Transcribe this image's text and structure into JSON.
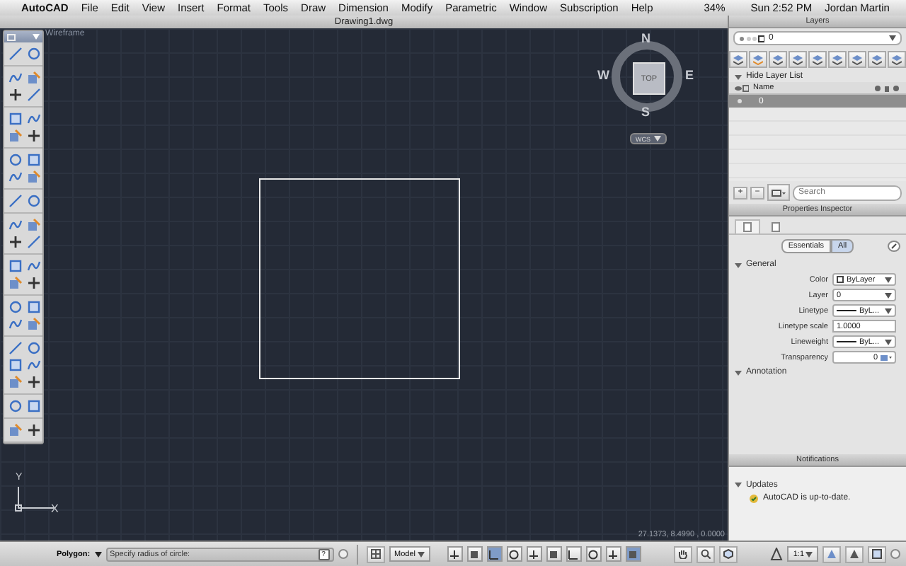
{
  "menu_bar": {
    "app": "AutoCAD",
    "items": [
      "File",
      "Edit",
      "View",
      "Insert",
      "Format",
      "Tools",
      "Draw",
      "Dimension",
      "Modify",
      "Parametric",
      "Window",
      "Subscription",
      "Help"
    ],
    "battery": "34%",
    "clock": "Sun 2:52 PM",
    "user": "Jordan Martin"
  },
  "drawing": {
    "title": "Drawing1.dwg",
    "visual_style": "Wireframe",
    "viewcube": {
      "face": "TOP",
      "north": "N",
      "south": "S",
      "east": "E",
      "west": "W",
      "ucs": "WCS"
    },
    "ucs_axis": {
      "y": "Y",
      "x": "X"
    },
    "coordinates": "27.1373, 8.4990 , 0.0000"
  },
  "layers": {
    "title": "Layers",
    "current_layer": "0",
    "hide_label": "Hide Layer List",
    "column": "Name",
    "rows": [
      {
        "name": "0",
        "selected": true
      }
    ],
    "buttons": [
      "+",
      "−"
    ],
    "search": {
      "placeholder": "Search"
    }
  },
  "properties": {
    "title": "Properties Inspector",
    "tabs": [
      {
        "selected": true
      },
      {
        "selected": false
      }
    ],
    "modes": [
      {
        "label": "Essentials",
        "selected": false
      },
      {
        "label": "All",
        "selected": true
      }
    ],
    "sections": [
      {
        "title": "General",
        "expanded": true,
        "rows": [
          {
            "label": "Color",
            "value": "ByLayer",
            "kind": "color"
          },
          {
            "label": "Layer",
            "value": "0",
            "kind": "dropdown"
          },
          {
            "label": "Linetype",
            "value": "ByL...",
            "kind": "line"
          },
          {
            "label": "Linetype scale",
            "value": "1.0000",
            "kind": "text"
          },
          {
            "label": "Lineweight",
            "value": "ByL...",
            "kind": "line"
          },
          {
            "label": "Transparency",
            "value": "0",
            "kind": "transparency"
          }
        ]
      },
      {
        "title": "Annotation",
        "expanded": true
      }
    ]
  },
  "notifications": {
    "title": "Notifications",
    "section": "Updates",
    "message": "AutoCAD is up-to-date."
  },
  "status_bar": {
    "command_label": "Polygon:",
    "prompt": "Specify radius of circle:",
    "help": "?",
    "layout": "Model",
    "toggles": [
      {
        "on": false
      },
      {
        "on": false
      },
      {
        "on": true
      },
      {
        "on": false
      },
      {
        "on": false
      },
      {
        "on": false
      },
      {
        "on": false
      },
      {
        "on": false
      },
      {
        "on": false
      },
      {
        "on": true
      }
    ],
    "scale": "1:1"
  }
}
